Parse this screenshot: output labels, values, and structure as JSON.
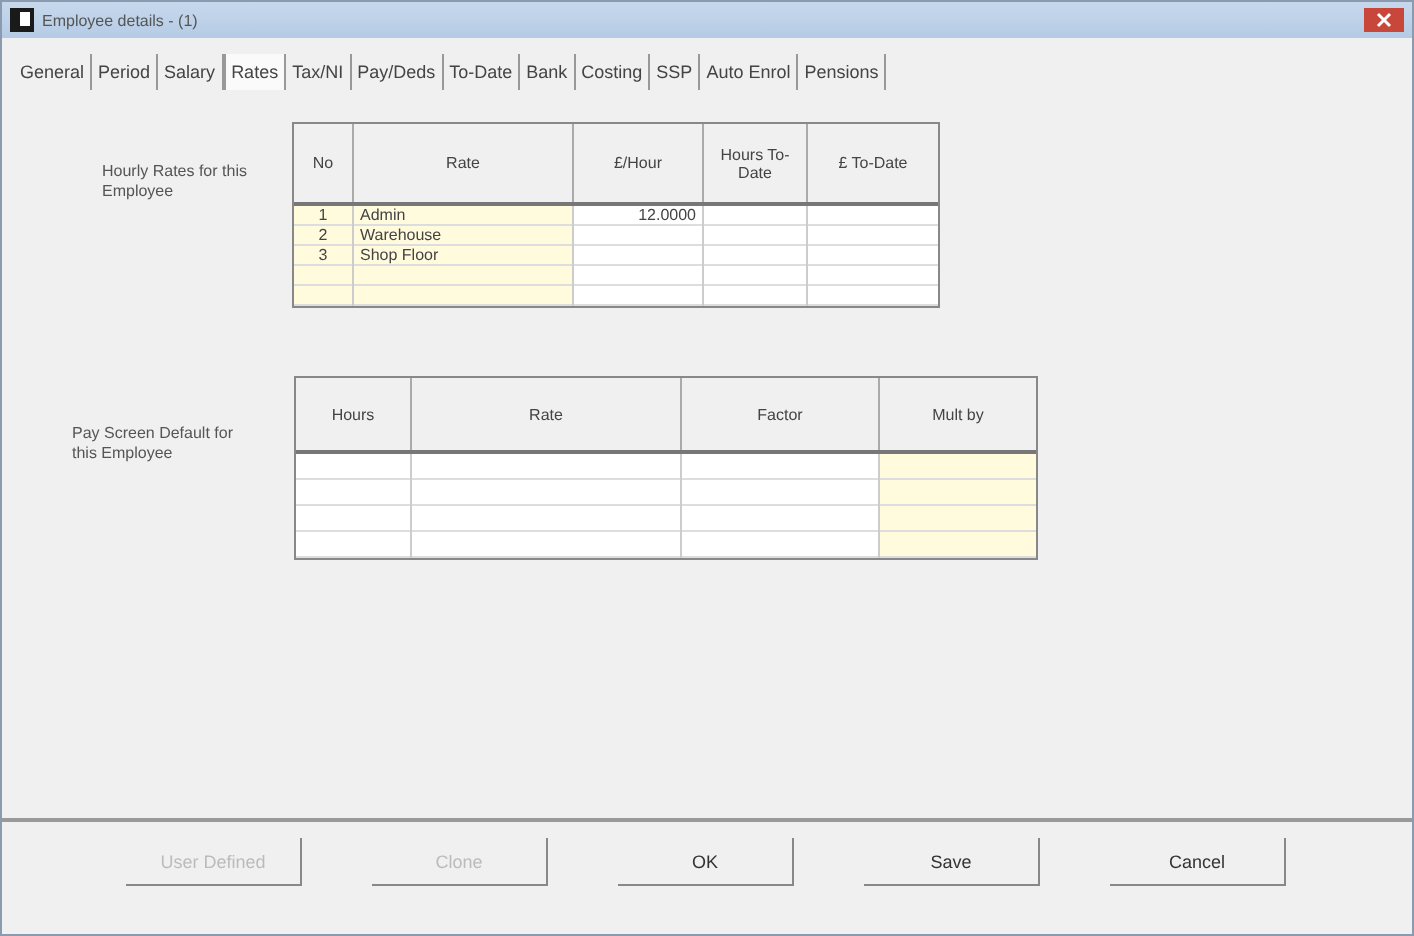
{
  "window": {
    "title": "Employee details - (1)"
  },
  "tabs": [
    {
      "label": "General",
      "selected": false
    },
    {
      "label": "Period",
      "selected": false
    },
    {
      "label": "Salary",
      "selected": false
    },
    {
      "label": "Rates",
      "selected": true
    },
    {
      "label": "Tax/NI",
      "selected": false
    },
    {
      "label": "Pay/Deds",
      "selected": false
    },
    {
      "label": "To-Date",
      "selected": false
    },
    {
      "label": "Bank",
      "selected": false
    },
    {
      "label": "Costing",
      "selected": false
    },
    {
      "label": "SSP",
      "selected": false
    },
    {
      "label": "Auto Enrol",
      "selected": false
    },
    {
      "label": "Pensions",
      "selected": false
    }
  ],
  "hourly_rates": {
    "label": "Hourly Rates for this Employee",
    "columns": [
      {
        "title": "No",
        "highlight": true
      },
      {
        "title": "Rate",
        "highlight": true
      },
      {
        "title": "£/Hour",
        "highlight": false
      },
      {
        "title": "Hours To-Date",
        "highlight": false
      },
      {
        "title": "£ To-Date",
        "highlight": false
      }
    ],
    "rows": [
      [
        "1",
        "Admin",
        "12.0000"
      ],
      [
        "2",
        "Warehouse"
      ],
      [
        "3",
        "Shop Floor"
      ]
    ]
  },
  "pay_screen_default": {
    "label": "Pay Screen Default for this Employee",
    "columns": [
      {
        "title": "Hours",
        "highlight": false
      },
      {
        "title": "Rate",
        "highlight": false
      },
      {
        "title": "Factor",
        "highlight": false
      },
      {
        "title": "Mult by",
        "highlight": true
      }
    ]
  },
  "buttons": [
    {
      "label": "User Defined",
      "disabled": true
    },
    {
      "label": "Clone",
      "disabled": true
    },
    {
      "label": "OK",
      "disabled": false
    },
    {
      "label": "Save",
      "disabled": false
    },
    {
      "label": "Cancel",
      "disabled": false
    }
  ]
}
